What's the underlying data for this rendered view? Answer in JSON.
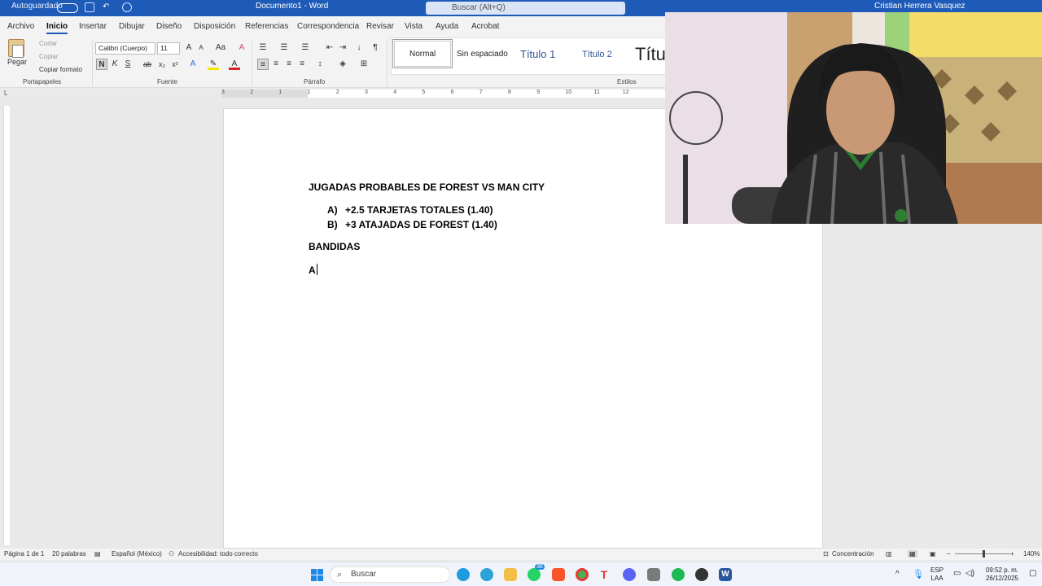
{
  "titlebar": {
    "autosave": "Autoguardado",
    "doc_title": "Documento1 - Word",
    "search_placeholder": "Buscar (Alt+Q)",
    "user": "Cristian Herrera Vasquez"
  },
  "tabs": [
    "Archivo",
    "Inicio",
    "Insertar",
    "Dibujar",
    "Diseño",
    "Disposición",
    "Referencias",
    "Correspondencia",
    "Revisar",
    "Vista",
    "Ayuda",
    "Acrobat"
  ],
  "ribbon": {
    "clipboard": {
      "paste": "Pegar",
      "cut": "Cortar",
      "copy": "Copiar",
      "format_painter": "Copiar formato",
      "label": "Portapapeles"
    },
    "font": {
      "name": "Calibri (Cuerpo)",
      "size": "11",
      "label": "Fuente",
      "bold": "N",
      "italic": "K",
      "underline": "S",
      "strike": "ab"
    },
    "paragraph": {
      "label": "Párrafo"
    },
    "styles": {
      "label": "Estilos",
      "items": [
        "Normal",
        "Sin espaciado",
        "Título 1",
        "Título 2",
        "Títu"
      ]
    }
  },
  "ruler": {
    "ticks": [
      "3",
      "2",
      "1",
      "1",
      "2",
      "3",
      "4",
      "5",
      "6",
      "7",
      "8",
      "9",
      "10",
      "11",
      "12"
    ]
  },
  "document": {
    "heading": "JUGADAS PROBABLES DE FOREST VS MAN CITY",
    "items": [
      {
        "marker": "A)",
        "text": "+2.5 TARJETAS TOTALES (1.40)"
      },
      {
        "marker": "B)",
        "text": "+3 ATAJADAS DE FOREST (1.40)"
      }
    ],
    "section": "BANDIDAS",
    "typing": "A"
  },
  "statusbar": {
    "page": "Página 1 de 1",
    "words": "20 palabras",
    "language": "Español (México)",
    "accessibility": "Accesibilidad: todo correcto",
    "focus": "Concentración",
    "zoom": "140%"
  },
  "taskbar": {
    "search": "Buscar",
    "badge": "36",
    "lang_top": "ESP",
    "lang_bottom": "LAA",
    "time": "09:52 p. m.",
    "date": "26/12/2025"
  },
  "colors": {
    "accent": "#1e5bb8",
    "page": "#ffffff",
    "workspace": "#e9e9e9"
  }
}
